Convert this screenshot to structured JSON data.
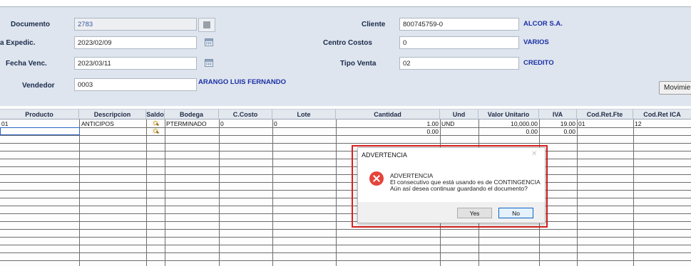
{
  "form": {
    "documento": {
      "label": "Documento",
      "value": "2783"
    },
    "fecha_expedicion": {
      "label": "a Expedic.",
      "value": "2023/02/09"
    },
    "fecha_vencimiento": {
      "label": "Fecha Venc.",
      "value": "2023/03/11"
    },
    "vendedor": {
      "label": "Vendedor",
      "value": "0003",
      "name": "ARANGO LUIS FERNANDO"
    },
    "cliente": {
      "label": "Cliente",
      "value": "800745759-0",
      "name": "ALCOR S.A."
    },
    "centro_costos": {
      "label": "Centro Costos",
      "value": "0",
      "name": "VARIOS"
    },
    "tipo_venta": {
      "label": "Tipo Venta",
      "value": "02",
      "name": "CREDITO"
    },
    "movimientos_button": "Movimient"
  },
  "grid": {
    "columns": [
      "Producto",
      "Descripcion",
      "Saldo",
      "Bodega",
      "C.Costo",
      "Lote",
      "Cantidad",
      "Und",
      "Valor Unitario",
      "IVA",
      "Cod.Ret.Fte",
      "Cod.Ret ICA"
    ],
    "rows": [
      {
        "producto": "01",
        "descripcion": "ANTICIPOS",
        "bodega": "PTERMINADO",
        "ccosto": "0",
        "lote": "0",
        "cantidad": "1.00",
        "und": "UND",
        "valor": "10,000.00",
        "iva": "19.00",
        "retfte": "01",
        "retica": "12"
      },
      {
        "producto": "",
        "descripcion": "",
        "bodega": "",
        "ccosto": "",
        "lote": "",
        "cantidad": "0.00",
        "und": "",
        "valor": "0.00",
        "iva": "0.00",
        "retfte": "",
        "retica": ""
      }
    ]
  },
  "dialog": {
    "title": "ADVERTENCIA",
    "close_glyph": "✕",
    "heading": "ADVERTENCIA",
    "line1": "El consecutivo que está usando es de CONTINGENCIA",
    "line2": "Aún así desea continuar guardando el documento?",
    "yes_label": "Yes",
    "no_label": "No"
  },
  "icons": {
    "calendar": "calendar-icon",
    "search": "search-icon",
    "error": "error-icon"
  },
  "colors": {
    "form_background": "#dee5ee",
    "label": "#1a2a4a",
    "value_name": "#1b2fa6",
    "highlight_border": "#d9201f",
    "error_icon": "#e5443b"
  }
}
